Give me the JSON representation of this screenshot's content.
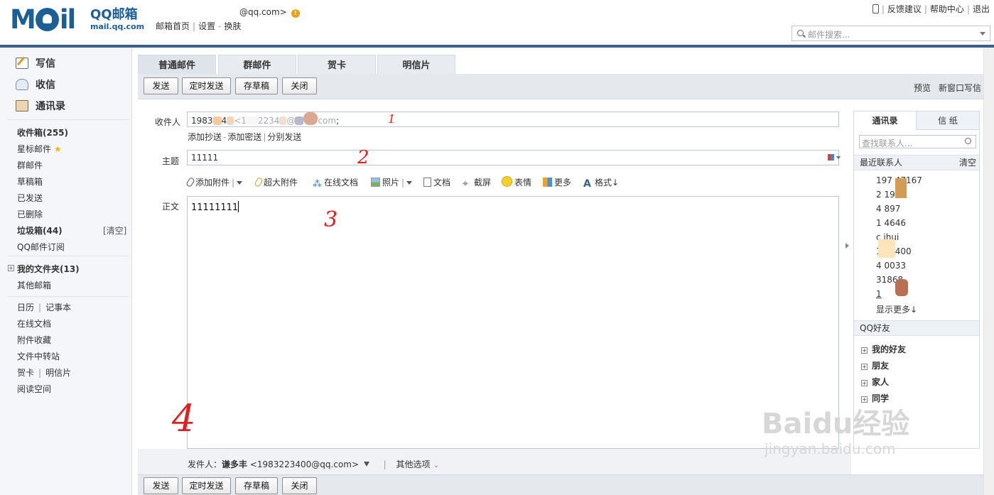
{
  "header": {
    "logo_text_left": "M",
    "logo_text_right": "il",
    "logo_qq": "QQ邮箱",
    "logo_url": "mail.qq.com",
    "account_email": "@qq.com>",
    "links": [
      "邮箱首页",
      "设置",
      "换肤"
    ],
    "top_right": [
      "反馈建议",
      "帮助中心",
      "退出"
    ],
    "search_placeholder": "邮件搜索..."
  },
  "sidebar": {
    "main": [
      "写信",
      "收信",
      "通讯录"
    ],
    "folders": [
      {
        "label": "收件箱(255)",
        "bold": true
      },
      {
        "label": "星标邮件",
        "star": true
      },
      {
        "label": "群邮件"
      },
      {
        "label": "草稿箱"
      },
      {
        "label": "已发送"
      },
      {
        "label": "已删除"
      },
      {
        "label": "垃圾箱(44)",
        "bold": true
      },
      {
        "label": "QQ邮件订阅"
      }
    ],
    "clear_label": "[清空]",
    "my_folders": "我的文件夹(13)",
    "other_mailbox": "其他邮箱",
    "tools": [
      "日历",
      "记事本",
      "在线文档",
      "附件收藏",
      "文件中转站",
      "贺卡",
      "明信片",
      "阅读空间"
    ]
  },
  "compose": {
    "tabs": [
      "普通邮件",
      "群邮件",
      "贺卡",
      "明信片"
    ],
    "toolbar_buttons": [
      "发送",
      "定时发送",
      "存草稿",
      "关闭"
    ],
    "toolbar_right": [
      "预览",
      "新窗口写信"
    ],
    "to_label": "收件人",
    "to_value_parts": [
      "1983",
      "4",
      "<1",
      "2234",
      "@",
      "com",
      ";"
    ],
    "cc_links": [
      "添加抄送",
      "添加密送",
      "分别发送"
    ],
    "subject_label": "主题",
    "subject_value": "11111",
    "attach_tools": [
      "添加附件",
      "超大附件",
      "在线文档",
      "照片",
      "文档",
      "截屏",
      "表情",
      "更多",
      "格式↓"
    ],
    "body_label": "正文",
    "body_value": "11111111",
    "sender_label": "发件人：",
    "sender_name": "谦多丰",
    "sender_email": "<1983223400@qq.com>",
    "other_options": "其他选项",
    "annotations": [
      "1",
      "2",
      "3",
      "4"
    ]
  },
  "contacts_panel": {
    "tabs": [
      "通讯录",
      "信 纸"
    ],
    "search_placeholder": "查找联系人...",
    "recent_label": "最近联系人",
    "clear_label": "清空",
    "recent": [
      "197    47167",
      "2      1923",
      "4        897",
      "1      4646",
      "c       ihui",
      "1      23400",
      "4      0033",
      "       31868",
      "1"
    ],
    "show_more": "显示更多↓",
    "qq_friends_label": "QQ好友",
    "groups": [
      "我的好友",
      "朋友",
      "家人",
      "同学"
    ]
  },
  "watermark": {
    "big": "Baidu经验",
    "small": "jingyan.baidu.com"
  }
}
